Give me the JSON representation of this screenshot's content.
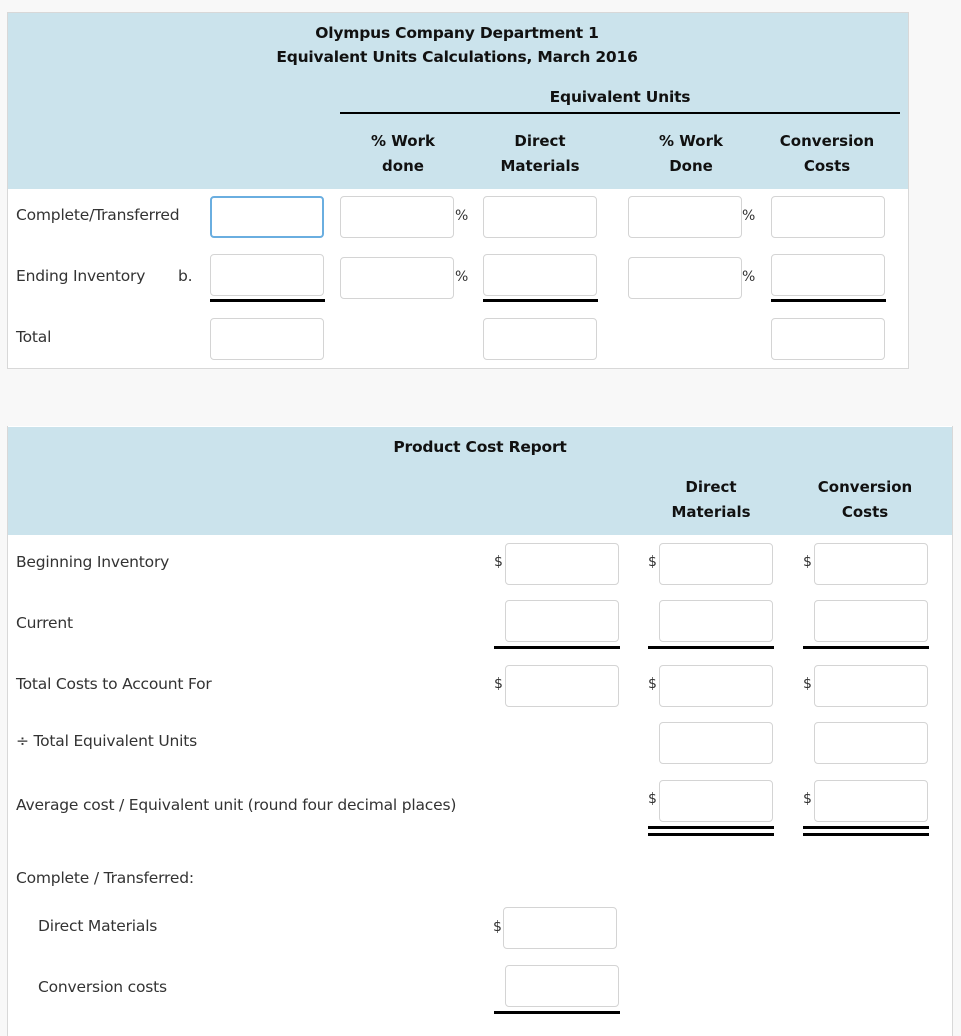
{
  "equivalent_units": {
    "title_line1": "Olympus Company Department 1",
    "title_line2": "Equivalent Units Calculations, March 2016",
    "group_header": "Equivalent Units",
    "columns": [
      {
        "label": "% Work\ndone"
      },
      {
        "label": "Direct\nMaterials"
      },
      {
        "label": "% Work\nDone"
      },
      {
        "label": "Conversion\nCosts"
      }
    ],
    "rows": [
      {
        "label": "Complete/Transferred",
        "sub_label": "",
        "units": "",
        "pct_work_dm": "",
        "direct_materials": "",
        "pct_work_cc": "",
        "conversion_costs": ""
      },
      {
        "label": "Ending Inventory",
        "sub_label": "b.",
        "units": "",
        "pct_work_dm": "",
        "direct_materials": "",
        "pct_work_cc": "",
        "conversion_costs": ""
      },
      {
        "label": "Total",
        "sub_label": "",
        "units": "",
        "direct_materials": "",
        "conversion_costs": ""
      }
    ],
    "percent_symbol": "%"
  },
  "product_cost_report": {
    "title": "Product Cost Report",
    "columns": [
      {
        "label": ""
      },
      {
        "label": "Direct\nMaterials"
      },
      {
        "label": "Conversion\nCosts"
      }
    ],
    "rows": [
      {
        "label": "Beginning Inventory",
        "total": "",
        "direct_materials": "",
        "conversion_costs": ""
      },
      {
        "label": "Current",
        "total": "",
        "direct_materials": "",
        "conversion_costs": ""
      },
      {
        "label": "Total Costs to Account For",
        "total": "",
        "direct_materials": "",
        "conversion_costs": ""
      },
      {
        "label": "÷ Total Equivalent Units",
        "direct_materials": "",
        "conversion_costs": ""
      },
      {
        "label": "Average cost / Equivalent unit (round four decimal places)",
        "direct_materials": "",
        "conversion_costs": ""
      }
    ],
    "transferred_heading": "Complete / Transferred:",
    "transferred_rows": [
      {
        "label": "Direct Materials",
        "value": ""
      },
      {
        "label": "Conversion costs",
        "value": ""
      }
    ],
    "currency_symbol": "$"
  }
}
